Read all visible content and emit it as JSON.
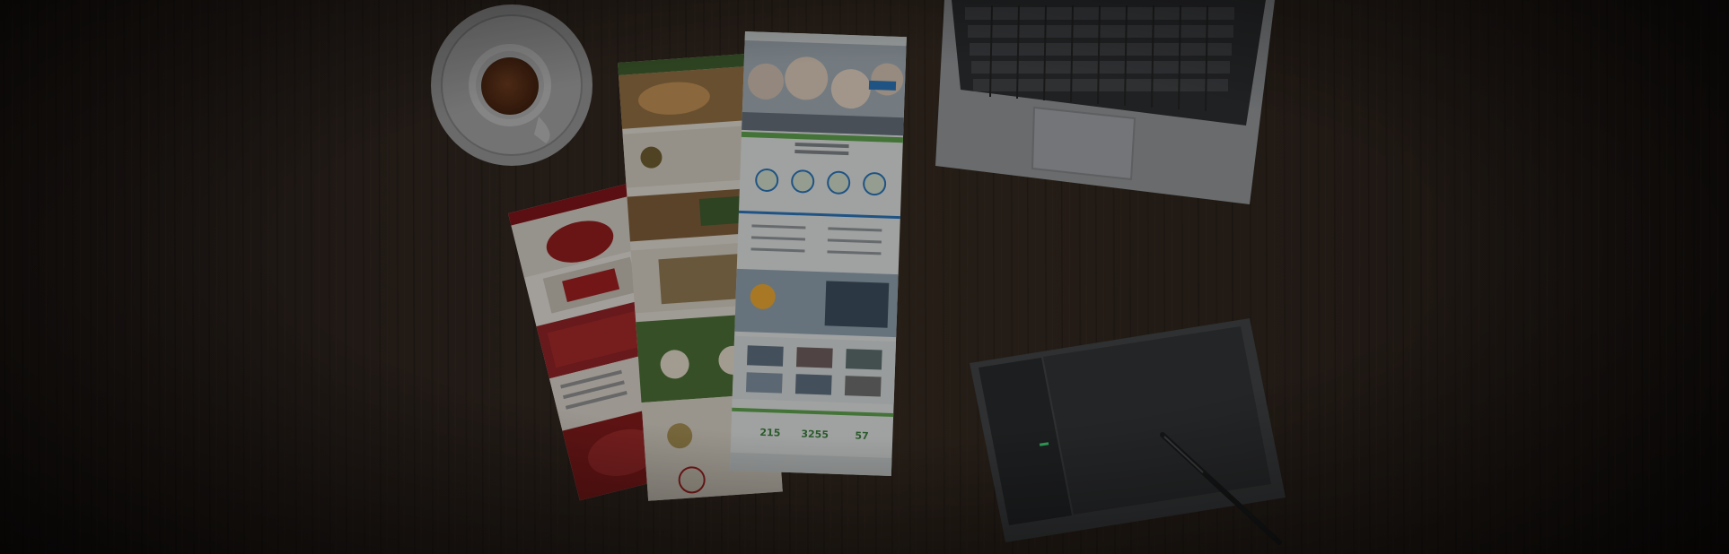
{
  "scene": {
    "description_visible_text": [],
    "stats": [
      "215",
      "3255",
      "57"
    ],
    "colors": {
      "wood_dark": "#1e1814",
      "wood_mid": "#2e2520",
      "accent_green": "#5a9a4a",
      "accent_blue": "#2a6fb0",
      "accent_red": "#b8282c",
      "vignette": "#000000"
    }
  }
}
